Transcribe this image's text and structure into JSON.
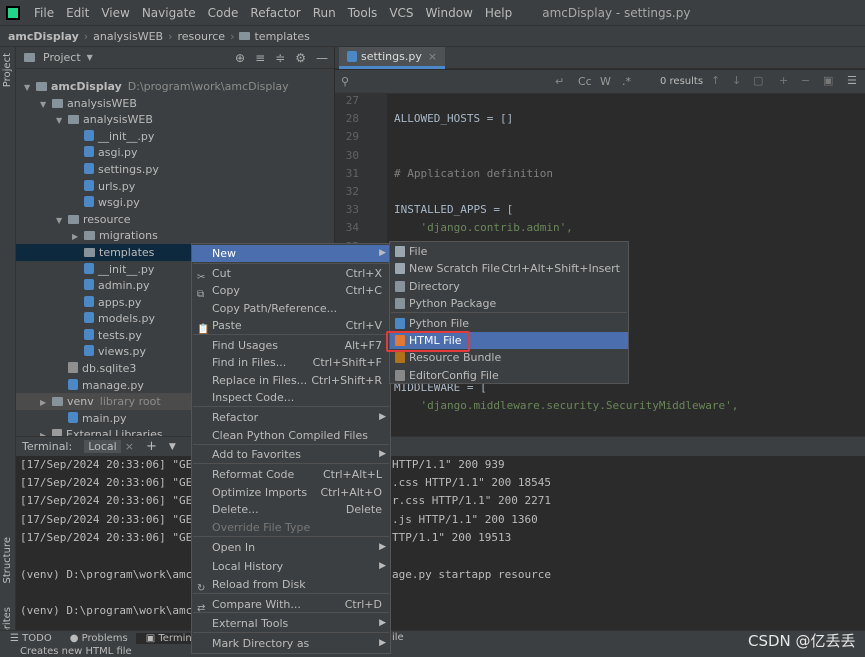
{
  "menubar": {
    "items": [
      "File",
      "Edit",
      "View",
      "Navigate",
      "Code",
      "Refactor",
      "Run",
      "Tools",
      "VCS",
      "Window",
      "Help"
    ],
    "window_title": "amcDisplay - settings.py"
  },
  "breadcrumb": [
    "amcDisplay",
    "analysisWEB",
    "resource",
    "templates"
  ],
  "left_strip": {
    "project": "Project",
    "structure": "Structure",
    "favorites": "Favorites"
  },
  "project": {
    "title": "Project",
    "tree": [
      {
        "label": "amcDisplay",
        "extra": "D:\\program\\work\\amcDisplay",
        "icon": "folder"
      },
      {
        "label": "analysisWEB",
        "icon": "folder"
      },
      {
        "label": "analysisWEB",
        "icon": "folder"
      },
      {
        "label": "__init__.py",
        "icon": "py"
      },
      {
        "label": "asgi.py",
        "icon": "py"
      },
      {
        "label": "settings.py",
        "icon": "py"
      },
      {
        "label": "urls.py",
        "icon": "py"
      },
      {
        "label": "wsgi.py",
        "icon": "py"
      },
      {
        "label": "resource",
        "icon": "folder"
      },
      {
        "label": "migrations",
        "icon": "folder"
      },
      {
        "label": "templates",
        "icon": "folder"
      },
      {
        "label": "__init__.py",
        "icon": "py"
      },
      {
        "label": "admin.py",
        "icon": "py"
      },
      {
        "label": "apps.py",
        "icon": "py"
      },
      {
        "label": "models.py",
        "icon": "py"
      },
      {
        "label": "tests.py",
        "icon": "py"
      },
      {
        "label": "views.py",
        "icon": "py"
      },
      {
        "label": "db.sqlite3",
        "icon": "db"
      },
      {
        "label": "manage.py",
        "icon": "py"
      },
      {
        "label": "venv",
        "extra": "library root",
        "icon": "folder"
      },
      {
        "label": "main.py",
        "icon": "py"
      },
      {
        "label": "External Libraries",
        "icon": "lib"
      }
    ]
  },
  "editor": {
    "tab": "settings.py",
    "search": {
      "results": "0 results",
      "cc": "Cc",
      "w": "W"
    },
    "lines": [
      {
        "n": "27",
        "code": ""
      },
      {
        "n": "28",
        "code": "ALLOWED_HOSTS = []"
      },
      {
        "n": "29",
        "code": ""
      },
      {
        "n": "30",
        "code": ""
      },
      {
        "n": "31",
        "code": "# Application definition"
      },
      {
        "n": "32",
        "code": ""
      },
      {
        "n": "33",
        "code": "INSTALLED_APPS = ["
      },
      {
        "n": "34",
        "code": "    'django.contrib.admin',"
      },
      {
        "n": "35",
        "code": ""
      }
    ],
    "after_menu_lines": [
      "MIDDLEWARE = [",
      "    'django.middleware.security.SecurityMiddleware',"
    ]
  },
  "terminal": {
    "title": "Terminal:",
    "tab": "Local",
    "lines": [
      "[17/Sep/2024 20:33:06] \"GE",
      "[17/Sep/2024 20:33:06] \"GE",
      "[17/Sep/2024 20:33:06] \"GE",
      "[17/Sep/2024 20:33:06] \"GE",
      "[17/Sep/2024 20:33:06] \"GE",
      "",
      "(venv) D:\\program\\work\\amc",
      "",
      "(venv) D:\\program\\work\\amc"
    ],
    "right_lines": [
      "HTTP/1.1\" 200 939",
      ".css HTTP/1.1\" 200 18545",
      "r.css HTTP/1.1\" 200 2271",
      ".js HTTP/1.1\" 200 1360",
      "TTP/1.1\" 200 19513",
      "",
      "age.py startapp resource"
    ]
  },
  "bottom_bar": {
    "todo": "TODO",
    "problems": "Problems",
    "terminal": "Termin",
    "file": "ile"
  },
  "status_bar": {
    "text": "Creates new HTML file"
  },
  "context_menu": {
    "items": [
      {
        "label": "New",
        "shortcut": "",
        "submenu": true
      },
      {
        "label": "Cut",
        "shortcut": "Ctrl+X"
      },
      {
        "label": "Copy",
        "shortcut": "Ctrl+C"
      },
      {
        "label": "Copy Path/Reference...",
        "shortcut": ""
      },
      {
        "label": "Paste",
        "shortcut": "Ctrl+V"
      },
      {
        "label": "Find Usages",
        "shortcut": "Alt+F7"
      },
      {
        "label": "Find in Files...",
        "shortcut": "Ctrl+Shift+F"
      },
      {
        "label": "Replace in Files...",
        "shortcut": "Ctrl+Shift+R"
      },
      {
        "label": "Inspect Code...",
        "shortcut": ""
      },
      {
        "label": "Refactor",
        "shortcut": "",
        "submenu": true
      },
      {
        "label": "Clean Python Compiled Files",
        "shortcut": ""
      },
      {
        "label": "Add to Favorites",
        "shortcut": "",
        "submenu": true
      },
      {
        "label": "Reformat Code",
        "shortcut": "Ctrl+Alt+L"
      },
      {
        "label": "Optimize Imports",
        "shortcut": "Ctrl+Alt+O"
      },
      {
        "label": "Delete...",
        "shortcut": "Delete"
      },
      {
        "label": "Override File Type",
        "shortcut": "",
        "disabled": true
      },
      {
        "label": "Open In",
        "shortcut": "",
        "submenu": true
      },
      {
        "label": "Local History",
        "shortcut": "",
        "submenu": true
      },
      {
        "label": "Reload from Disk",
        "shortcut": ""
      },
      {
        "label": "Compare With...",
        "shortcut": "Ctrl+D"
      },
      {
        "label": "External Tools",
        "shortcut": "",
        "submenu": true
      },
      {
        "label": "Mark Directory as",
        "shortcut": "",
        "submenu": true
      }
    ]
  },
  "new_submenu": {
    "items": [
      {
        "label": "File",
        "shortcut": ""
      },
      {
        "label": "New Scratch File",
        "shortcut": "Ctrl+Alt+Shift+Insert"
      },
      {
        "label": "Directory",
        "shortcut": ""
      },
      {
        "label": "Python Package",
        "shortcut": ""
      },
      {
        "label": "Python File",
        "shortcut": ""
      },
      {
        "label": "HTML File",
        "shortcut": ""
      },
      {
        "label": "Resource Bundle",
        "shortcut": ""
      },
      {
        "label": "EditorConfig File",
        "shortcut": ""
      }
    ]
  },
  "watermark": "CSDN @亿丢丢",
  "colors": {
    "selection": "#4b6eaf",
    "highlight_box": "#e33b3b",
    "string": "#6a8759",
    "comment": "#808080"
  }
}
